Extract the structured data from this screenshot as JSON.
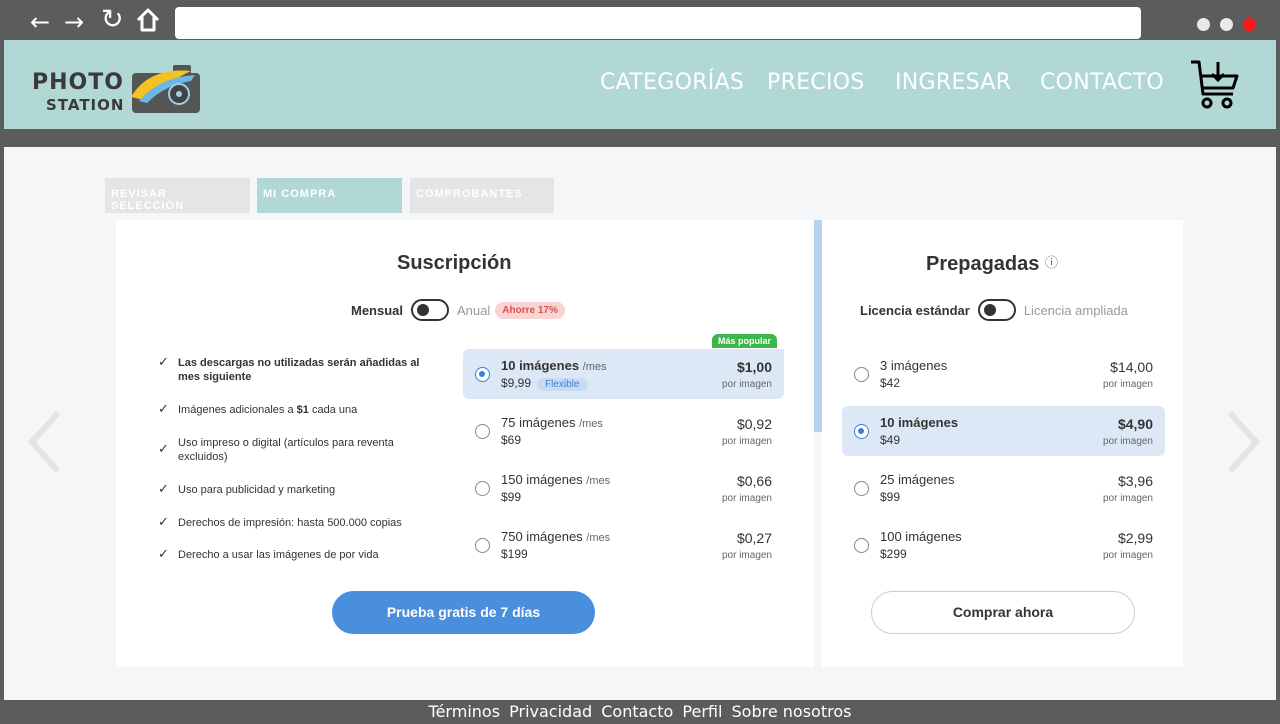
{
  "browser": {
    "back_icon": "arrow-left-icon",
    "forward_icon": "arrow-right-icon",
    "reload_icon": "reload-icon",
    "home_icon": "home-icon",
    "address": "",
    "window_dot_colors": [
      "#e9e9e9",
      "#e9e9e9",
      "#ff1a1a"
    ]
  },
  "header": {
    "logo_line1": "PHOTO",
    "logo_line2": "STATION",
    "nav": [
      "CATEGORÍAS",
      "PRECIOS",
      "INGRESAR",
      "CONTACTO"
    ],
    "cart_icon": "cart-download-icon"
  },
  "steps": {
    "items": [
      "REVISAR SELECCIÓN",
      "MI COMPRA",
      "COMPROBANTES"
    ],
    "active_index": 1
  },
  "subscription": {
    "title": "Suscripción",
    "toggle_left": "Mensual",
    "toggle_right": "Anual",
    "save_badge": "Ahorre 17%",
    "features": [
      {
        "html_bold": true,
        "text": "Las descargas no utilizadas serán añadidas al mes siguiente"
      },
      {
        "html_bold": false,
        "text_before": "Imágenes adicionales a ",
        "bold_part": "$1",
        "text_after": " cada una"
      },
      {
        "html_bold": false,
        "text": "Uso impreso o digital (artículos para reventa excluidos)"
      },
      {
        "html_bold": false,
        "text": "Uso para publicidad y marketing"
      },
      {
        "html_bold": false,
        "text": "Derechos de impresión: hasta 500.000 copias"
      },
      {
        "html_bold": false,
        "text": "Derecho a usar las imágenes de por vida"
      }
    ],
    "popular_badge": "Más popular",
    "per_month": "/mes",
    "per_image": "por imagen",
    "flex_badge": "Flexible",
    "options": [
      {
        "name": "10 imágenes",
        "price": "$9,99",
        "unit": "$1,00",
        "selected": true
      },
      {
        "name": "75 imágenes",
        "price": "$69",
        "unit": "$0,92",
        "selected": false
      },
      {
        "name": "150 imágenes",
        "price": "$99",
        "unit": "$0,66",
        "selected": false
      },
      {
        "name": "750 imágenes",
        "price": "$199",
        "unit": "$0,27",
        "selected": false
      }
    ],
    "cta": "Prueba gratis de 7 días"
  },
  "prepaid": {
    "title": "Prepagadas",
    "help_icon": "question-circle-icon",
    "toggle_left": "Licencia estándar",
    "toggle_right": "Licencia ampliada",
    "per_image": "por imagen",
    "options": [
      {
        "name": "3 imágenes",
        "price": "$42",
        "unit": "$14,00",
        "selected": false
      },
      {
        "name": "10 imágenes",
        "price": "$49",
        "unit": "$4,90",
        "selected": true
      },
      {
        "name": "25 imágenes",
        "price": "$99",
        "unit": "$3,96",
        "selected": false
      },
      {
        "name": "100 imágenes",
        "price": "$299",
        "unit": "$2,99",
        "selected": false
      }
    ],
    "cta": "Comprar ahora"
  },
  "carousel": {
    "prev_icon": "chevron-left-icon",
    "next_icon": "chevron-right-icon"
  },
  "footer": [
    "Términos",
    "Privacidad",
    "Contacto",
    "Perfil",
    "Sobre nosotros"
  ],
  "colors": {
    "header_bg": "#b2d8d6",
    "primary": "#4a8fde",
    "popular": "#3cb54a",
    "save_badge": "#d9534f"
  }
}
